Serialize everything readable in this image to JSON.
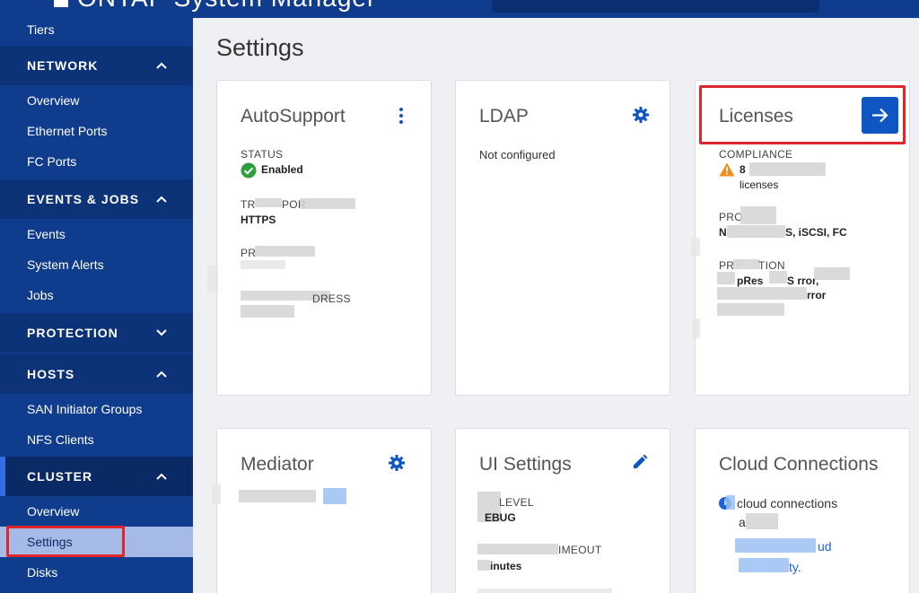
{
  "app": {
    "title": "ONTAP System Manager"
  },
  "sidebar": {
    "items": [
      {
        "label": "Tiers"
      },
      {
        "label": "NETWORK",
        "chevron": "^"
      },
      {
        "label": "Overview"
      },
      {
        "label": "Ethernet Ports"
      },
      {
        "label": "FC Ports"
      },
      {
        "label": "EVENTS & JOBS",
        "chevron": "^"
      },
      {
        "label": "Events"
      },
      {
        "label": "System Alerts"
      },
      {
        "label": "Jobs"
      },
      {
        "label": "PROTECTION",
        "chevron": "v"
      },
      {
        "label": "HOSTS",
        "chevron": "^"
      },
      {
        "label": "SAN Initiator Groups"
      },
      {
        "label": "NFS Clients"
      },
      {
        "label": "CLUSTER",
        "chevron": "^"
      },
      {
        "label": "Overview"
      },
      {
        "label": "Settings"
      },
      {
        "label": "Disks"
      }
    ]
  },
  "page": {
    "title": "Settings"
  },
  "cards": {
    "autosupport": {
      "title": "AutoSupport",
      "status_label": "STATUS",
      "status_value": "Enabled",
      "transport_label": "TR",
      "transport_label_tail": "POR",
      "transport_value": "HTTPS",
      "proxy_label": "PR",
      "address_label": "DRESS"
    },
    "ldap": {
      "title": "LDAP",
      "status": "Not configured"
    },
    "licenses": {
      "title": "Licenses",
      "compliance_label": "COMPLIANCE",
      "count": "8",
      "licenses_text": "licenses",
      "protocols_label": "PRO",
      "protocols_value": "S, iSCSI, FC",
      "protocols_prefix": "N",
      "protection_label": "PR",
      "protection_label_tail": "TION",
      "protection_value_1": "pRes",
      "protection_value_1_tail": "S    rror,",
      "protection_value_2": "rror"
    },
    "mediator": {
      "title": "Mediator"
    },
    "ui_settings": {
      "title": "UI Settings",
      "level_label": "LEVEL",
      "level_value": "EBUG",
      "timeout_label": "IMEOUT",
      "timeout_value": "inutes"
    },
    "cloud": {
      "title": "Cloud Connections",
      "text": "cloud connections",
      "line2": "a",
      "link1": "ud",
      "link2": "ty."
    }
  },
  "colors": {
    "sidebar_bg": "#0f3c8c",
    "accent": "#0f56c2",
    "highlight": "#e0252b",
    "success": "#2e9e3e",
    "warning": "#f28c1c"
  }
}
